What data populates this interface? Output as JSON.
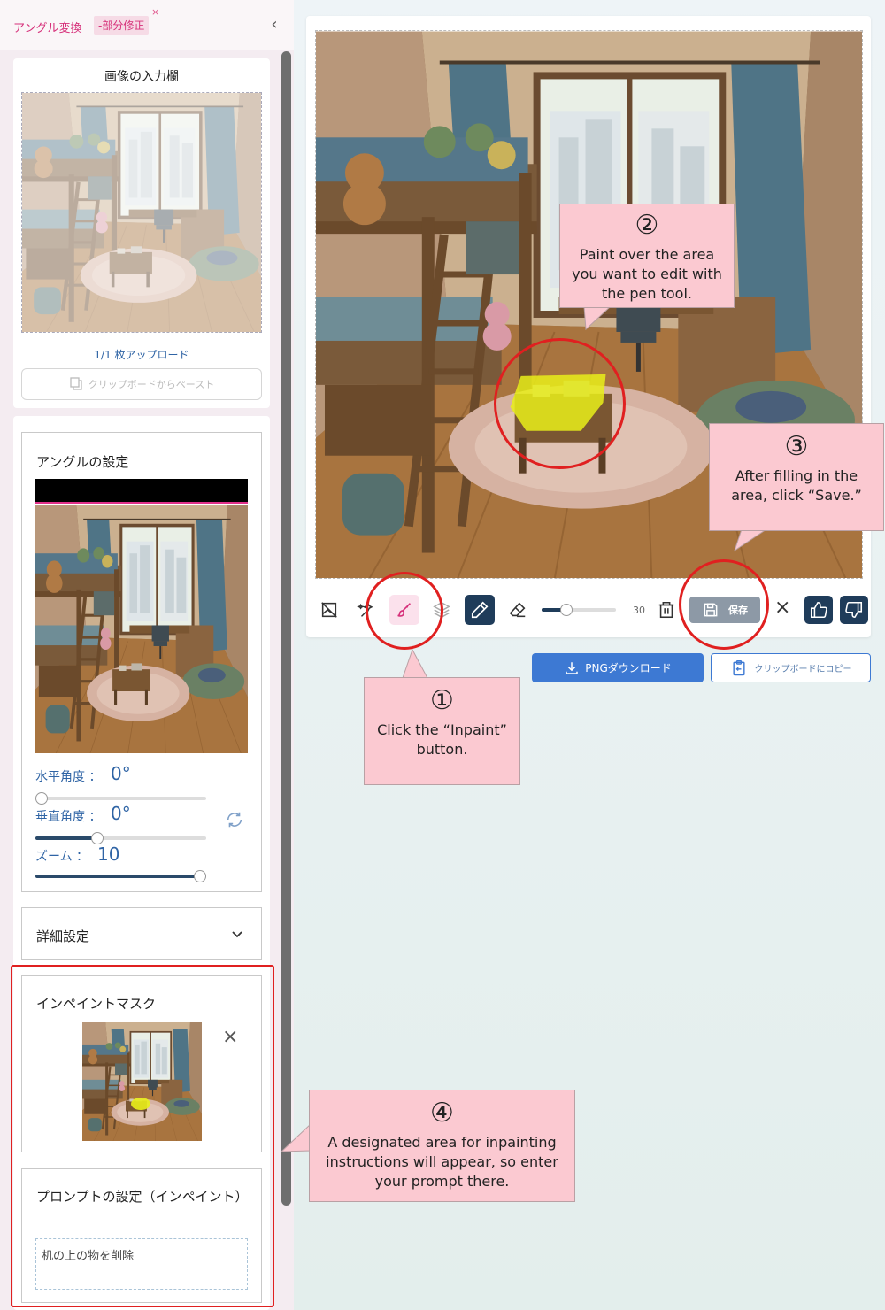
{
  "header": {
    "tab_title": "アングル変換",
    "tab_badge": "-部分修正",
    "tab_close": "×",
    "collapse": "‹"
  },
  "input_section": {
    "title": "画像の入力欄",
    "upload_count": "1/1 枚アップロード",
    "paste_button": "クリップボードからペースト"
  },
  "angle_section": {
    "title": "アングルの設定",
    "horizontal_label": "水平角度 ：",
    "horizontal_value": "0°",
    "horizontal_level": 0.0,
    "vertical_label": "垂直角度 ：",
    "vertical_value": "0°",
    "vertical_level": 0.35,
    "zoom_label": "ズーム ：",
    "zoom_value": "10",
    "zoom_level": 1.0
  },
  "advanced": {
    "title": "詳細設定"
  },
  "mask_section": {
    "title": "インペイントマスク",
    "close": "×"
  },
  "prompt_section": {
    "title": "プロンプトの設定（インペイント）",
    "value": "机の上の物を削除"
  },
  "toolbar": {
    "brush_size": "30",
    "brush_size_level": 0.3,
    "save_label": "保存",
    "close": "×"
  },
  "downloads": {
    "png_button": "PNGダウンロード",
    "copy_button": "クリップボードにコピー"
  },
  "callouts": {
    "c1_num": "①",
    "c1_text": "Click the “Inpaint” button.",
    "c2_num": "②",
    "c2_text": "Paint over the area you want to edit with the pen tool.",
    "c3_num": "③",
    "c3_text": "After filling in the area, click “Save.”",
    "c4_num": "④",
    "c4_text": "A designated area for inpainting instructions will appear, so enter your prompt there."
  },
  "colors": {
    "accent": "#d6307a",
    "primary_button": "#3d79d3",
    "dark_tool": "#1f3c5a",
    "callout_bg": "#fbc9d1",
    "highlight_ring": "#e02020",
    "mask_yellow": "#e9ee1a"
  }
}
